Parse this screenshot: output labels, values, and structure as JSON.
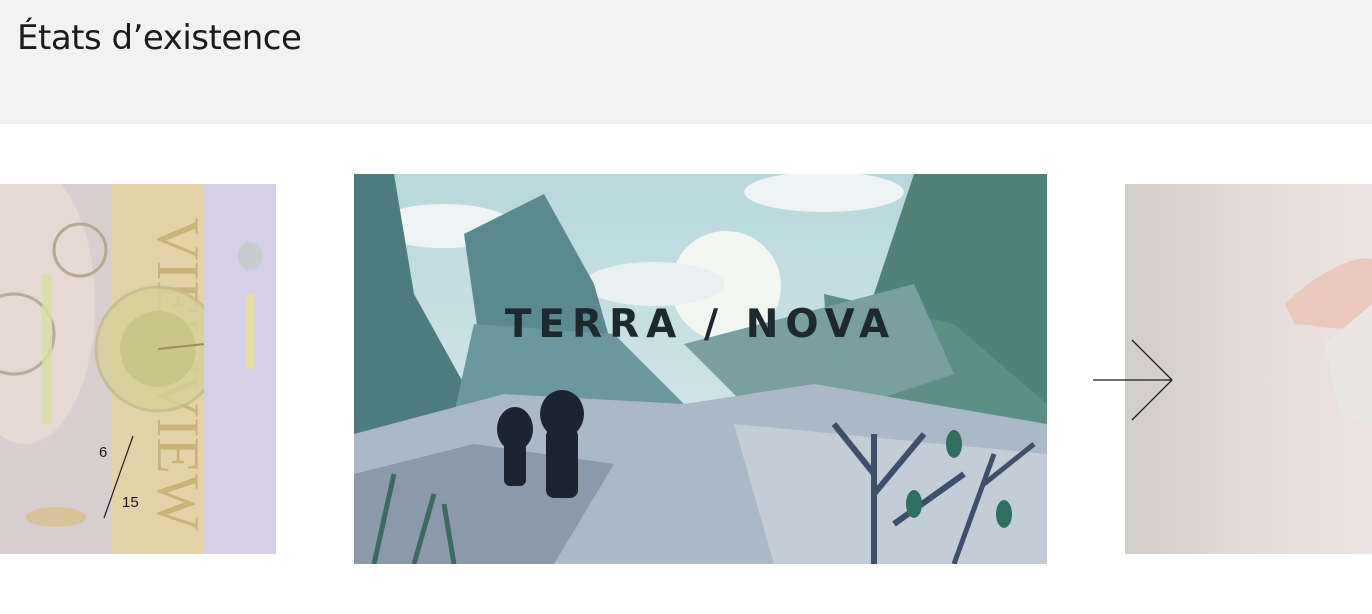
{
  "page": {
    "title": "États d’existence"
  },
  "carousel": {
    "counter": {
      "current": "6",
      "total": "15"
    },
    "slides": [
      {
        "id": "prev",
        "title": ""
      },
      {
        "id": "current",
        "title": "TERRA / NOVA"
      },
      {
        "id": "next",
        "title": ""
      }
    ],
    "next_button": {
      "icon": "arrow-right-icon"
    }
  }
}
